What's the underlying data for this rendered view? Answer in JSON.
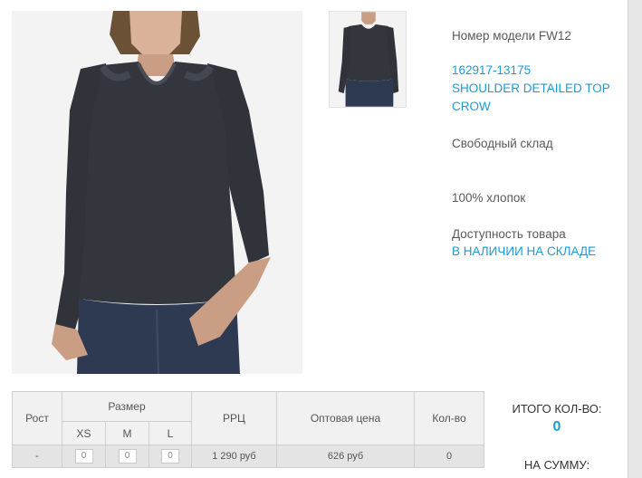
{
  "product": {
    "model_label": "Номер модели FW12",
    "sku": "162917-13175",
    "name_line1": "SHOULDER DETAILED TOP",
    "name_line2": "CROW",
    "warehouse": "Свободный склад",
    "material": "100% хлопок",
    "availability_label": "Доступность товара",
    "availability_value": "В НАЛИЧИИ НА СКЛАДЕ"
  },
  "table": {
    "headers": {
      "rost": "Рост",
      "size": "Размер",
      "rrc": "РРЦ",
      "wholesale": "Оптовая цена",
      "qty": "Кол-во"
    },
    "sizes": [
      "XS",
      "M",
      "L"
    ],
    "row": {
      "rost": "-",
      "qty_inputs": [
        "0",
        "0",
        "0"
      ],
      "rrc": "1 290 руб",
      "wholesale": "626 руб",
      "qty": "0"
    }
  },
  "totals": {
    "total_qty_label": "ИТОГО КОЛ-ВО:",
    "total_qty_value": "0",
    "total_sum_label": "НА СУММУ:"
  },
  "colors": {
    "accent": "#1d9ad6",
    "garment": "#33363d",
    "denim": "#2e3a52"
  }
}
